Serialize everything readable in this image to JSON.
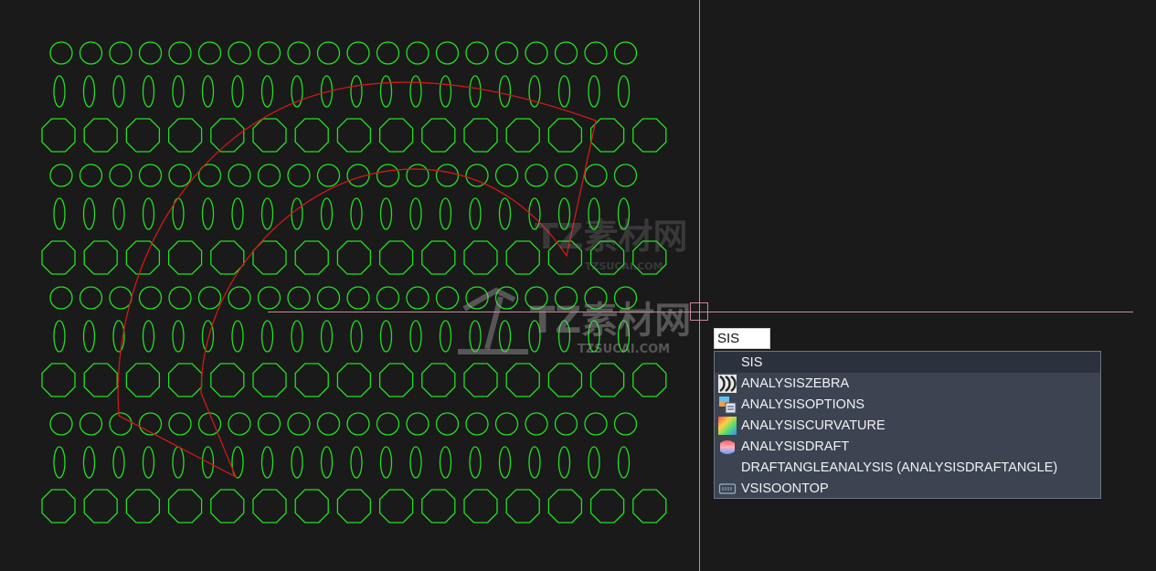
{
  "command_line": {
    "input_value": "SIS"
  },
  "autocomplete": {
    "items": [
      {
        "label": "SIS",
        "icon": "none",
        "selected": true
      },
      {
        "label": "ANALYSISZEBRA",
        "icon": "zebra-analysis-icon",
        "selected": false
      },
      {
        "label": "ANALYSISOPTIONS",
        "icon": "analysis-options-icon",
        "selected": false
      },
      {
        "label": "ANALYSISCURVATURE",
        "icon": "curvature-analysis-icon",
        "selected": false
      },
      {
        "label": "ANALYSISDRAFT",
        "icon": "draft-analysis-icon",
        "selected": false
      },
      {
        "label": "DRAFTANGLEANALYSIS (ANALYSISDRAFTANGLE)",
        "icon": "none",
        "selected": false
      },
      {
        "label": "VSISOONTOP",
        "icon": "vsisoontop-icon",
        "selected": false
      }
    ]
  },
  "watermark": {
    "brand": "TZ素材网",
    "domain": "TZSUCAI.COM"
  },
  "colors": {
    "background": "#1a1a1a",
    "geometry": "#22e022",
    "arc": "#d01818",
    "crosshair": "#c98a9a",
    "list_bg": "#3c4452"
  }
}
